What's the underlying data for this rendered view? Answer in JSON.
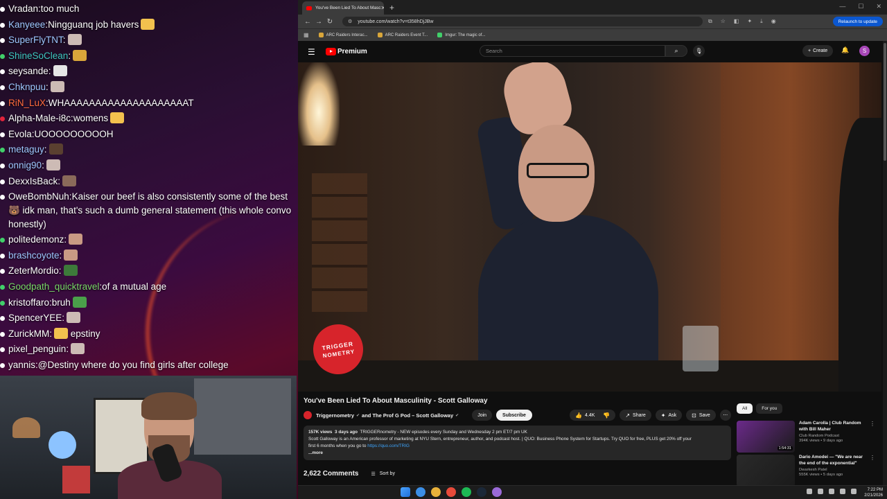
{
  "chat": [
    {
      "user": "Vradan",
      "text": "too much",
      "color": "#ffffff",
      "bullet": "#ffffff",
      "emote": null
    },
    {
      "user": "Kanyeee",
      "text": "Ningguanq job havers",
      "color": "#9ec7ff",
      "bullet": "#ffffff",
      "emote": "#f2c14e"
    },
    {
      "user": "SuperFlyTNT",
      "text": "",
      "color": "#9ec7ff",
      "bullet": "#ffffff",
      "emote": "#cdbbb5"
    },
    {
      "user": "ShineSoClean",
      "text": "",
      "color": "#3fc7c2",
      "bullet": "#41d06a",
      "emote": "#d9a63a"
    },
    {
      "user": "seysande",
      "text": "",
      "color": "#ffffff",
      "bullet": "#ffffff",
      "emote": "#e6e6e6"
    },
    {
      "user": "Chknpuu",
      "text": "",
      "color": "#9ec7ff",
      "bullet": "#ffffff",
      "emote": "#cdbbb5"
    },
    {
      "user": "RiN_LuX",
      "text": "WHAAAAAAAAAAAAAAAAAAAAT",
      "color": "#ff6b3d",
      "bullet": "#ffffff",
      "emote": null
    },
    {
      "user": "Alpha-Male-i8c",
      "text": "womens",
      "color": "#ffffff",
      "bullet": "#e0243b",
      "emote": "#f2c14e"
    },
    {
      "user": "Evola",
      "text": "UOOOOOOOOOH",
      "color": "#ffffff",
      "bullet": "#ffffff",
      "emote": null
    },
    {
      "user": "metaguy",
      "text": "",
      "color": "#9ec7ff",
      "bullet": "#41d06a",
      "emote": "#5a4030"
    },
    {
      "user": "onnig90",
      "text": "",
      "color": "#9ec7ff",
      "bullet": "#ffffff",
      "emote": "#cdbbb5"
    },
    {
      "user": "DexxIsBack",
      "text": "",
      "color": "#ffffff",
      "bullet": "#ffffff",
      "emote": "#8a6a5a"
    },
    {
      "user": "OweBombNuh",
      "text": "Kaiser our beef is also consistently some of the best 🐻 idk man, that's such a dumb general statement (this whole convo honestly)",
      "color": "#ffffff",
      "bullet": "#ffffff",
      "emote": null,
      "wrap": true
    },
    {
      "user": "politedemonz",
      "text": "",
      "color": "#ffffff",
      "bullet": "#41d06a",
      "emote": "#c99a84"
    },
    {
      "user": "brashcoyote",
      "text": "",
      "color": "#9ec7ff",
      "bullet": "#ffffff",
      "emote": "#c99a84"
    },
    {
      "user": "ZeterMordio",
      "text": "",
      "color": "#ffffff",
      "bullet": "#ffffff",
      "emote": "#3d7a3a"
    },
    {
      "user": "Goodpath_quicktravel",
      "text": "of a mutual age",
      "color": "#7bd96a",
      "bullet": "#41d06a",
      "emote": null
    },
    {
      "user": "kristoffaro",
      "text": "bruh",
      "color": "#ffffff",
      "bullet": "#41d06a",
      "emote": "#4aa04a"
    },
    {
      "user": "SpencerYEE",
      "text": "",
      "color": "#ffffff",
      "bullet": "#ffffff",
      "emote": "#cdbbb5"
    },
    {
      "user": "ZurickMM",
      "text": "epstiny",
      "color": "#ffffff",
      "bullet": "#ffffff",
      "emote": "#f2c14e"
    },
    {
      "user": "pixel_penguin",
      "text": "",
      "color": "#ffffff",
      "bullet": "#ffffff",
      "emote": "#cdbbb5"
    },
    {
      "user": "yannis",
      "text": "@Destiny where do you find girls after college",
      "color": "#ffffff",
      "bullet": "#ffffff",
      "emote": null
    }
  ],
  "browser": {
    "tab_title": "You've Been Lied To About Masc",
    "url": "youtube.com/watch?v=t358hDjJBw",
    "relaunch": "Relaunch to update",
    "bookmarks": [
      {
        "label": "ARC Raiders Interac...",
        "color": "#d9a63a"
      },
      {
        "label": "ARC Raiders Event T...",
        "color": "#d9a63a"
      },
      {
        "label": "Imgur: The magic of...",
        "color": "#41d06a"
      }
    ]
  },
  "youtube": {
    "logo_text": "Premium",
    "search_placeholder": "Search",
    "create_label": "Create",
    "avatar_letter": "S",
    "video_logo_line1": "TRIGGER",
    "video_logo_line2": "NOMETRY",
    "title": "You've Been Lied To About Masculinity - Scott Galloway",
    "channel": "Triggernometry",
    "channel_and": "and The Prof G Pod – Scott Galloway",
    "join": "Join",
    "subscribe": "Subscribe",
    "likes": "4.4K",
    "share": "Share",
    "ask": "Ask",
    "save": "Save",
    "description": {
      "views": "157K views",
      "age": "3 days ago",
      "tagline": "TRIGGERnometry - NEW episodes every Sunday and Wednesday 2 pm ET/7 pm UK",
      "line2": "Scott Galloway is an American professor of marketing at NYU Stern, entrepreneur, author, and podcast host. | QUO: Business Phone System for Startups. Try QUO for free, PLUS get 20% off your",
      "line3": "first 6 months when you go to",
      "link": "https://quo.com/TRIG",
      "more": "...more"
    },
    "comments_count": "2,622 Comments",
    "sort_by": "Sort by",
    "chips": [
      "All",
      "For you"
    ],
    "recommendations": [
      {
        "title": "Adam Carolla | Club Random with Bill Maher",
        "channel": "Club Random Podcast",
        "views": "394K views • 9 days ago",
        "duration": "1:54:31",
        "thumb": "#6b2a8a"
      },
      {
        "title": "Dario Amodei — \"We are near the end of the exponential\"",
        "channel": "Dwarkesh Patel",
        "views": "555K views • 5 days ago",
        "duration": "",
        "thumb": "#2a2a2a"
      }
    ]
  },
  "taskbar": {
    "time": "7:22 PM",
    "date": "2/21/2026",
    "apps": [
      "#3a8ee6",
      "#e8b13a",
      "#e84a3a",
      "#1db954",
      "#1b2838",
      "#9a6ad8"
    ]
  }
}
